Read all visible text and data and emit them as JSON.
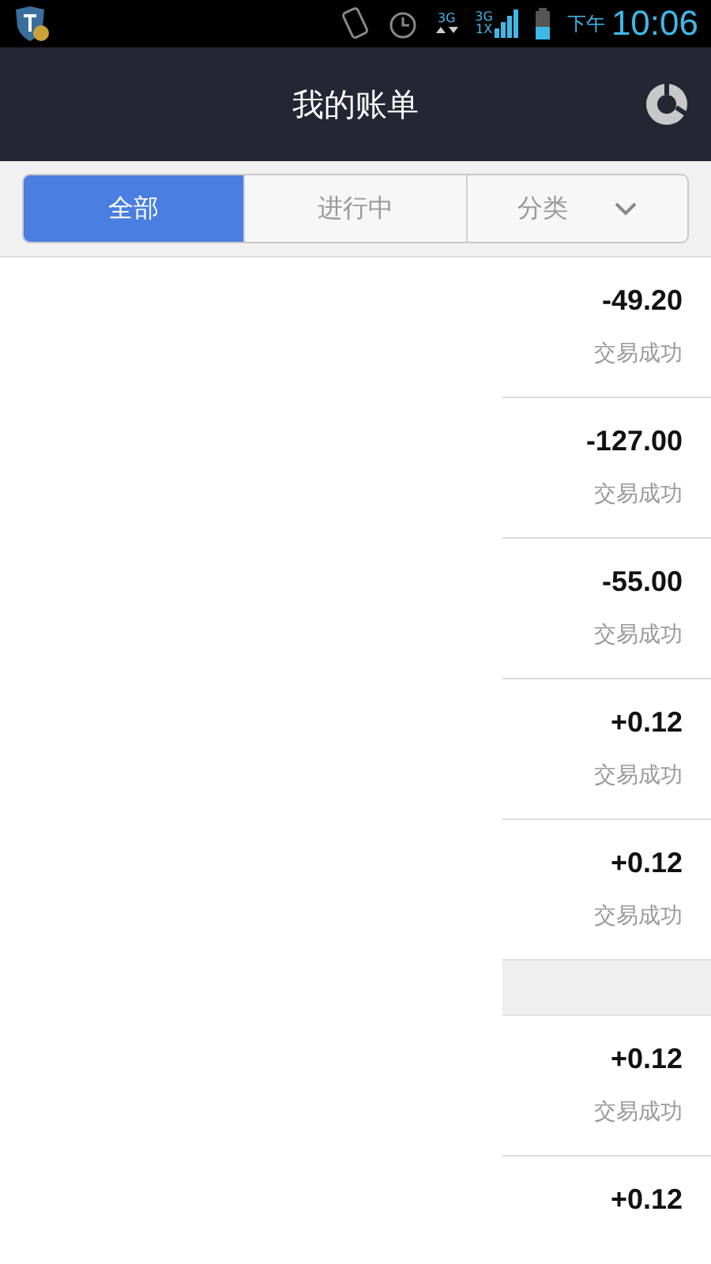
{
  "status_bar": {
    "data_type": "3G",
    "signal_type": "3G",
    "signal_type_2": "1X",
    "period": "下午",
    "time": "10:06"
  },
  "title_bar": {
    "title": "我的账单"
  },
  "filter_tabs": [
    {
      "label": "全部",
      "selected": true,
      "kind": "tab"
    },
    {
      "label": "进行中",
      "selected": false,
      "kind": "tab"
    },
    {
      "label": "分类",
      "selected": false,
      "kind": "dropdown"
    }
  ],
  "bill_groups": [
    {
      "items": [
        {
          "amount": "-49.20",
          "status": "交易成功"
        },
        {
          "amount": "-127.00",
          "status": "交易成功"
        },
        {
          "amount": "-55.00",
          "status": "交易成功"
        },
        {
          "amount": "+0.12",
          "status": "交易成功"
        },
        {
          "amount": "+0.12",
          "status": "交易成功"
        }
      ]
    },
    {
      "items": [
        {
          "amount": "+0.12",
          "status": "交易成功"
        },
        {
          "amount": "+0.12"
        }
      ]
    }
  ]
}
